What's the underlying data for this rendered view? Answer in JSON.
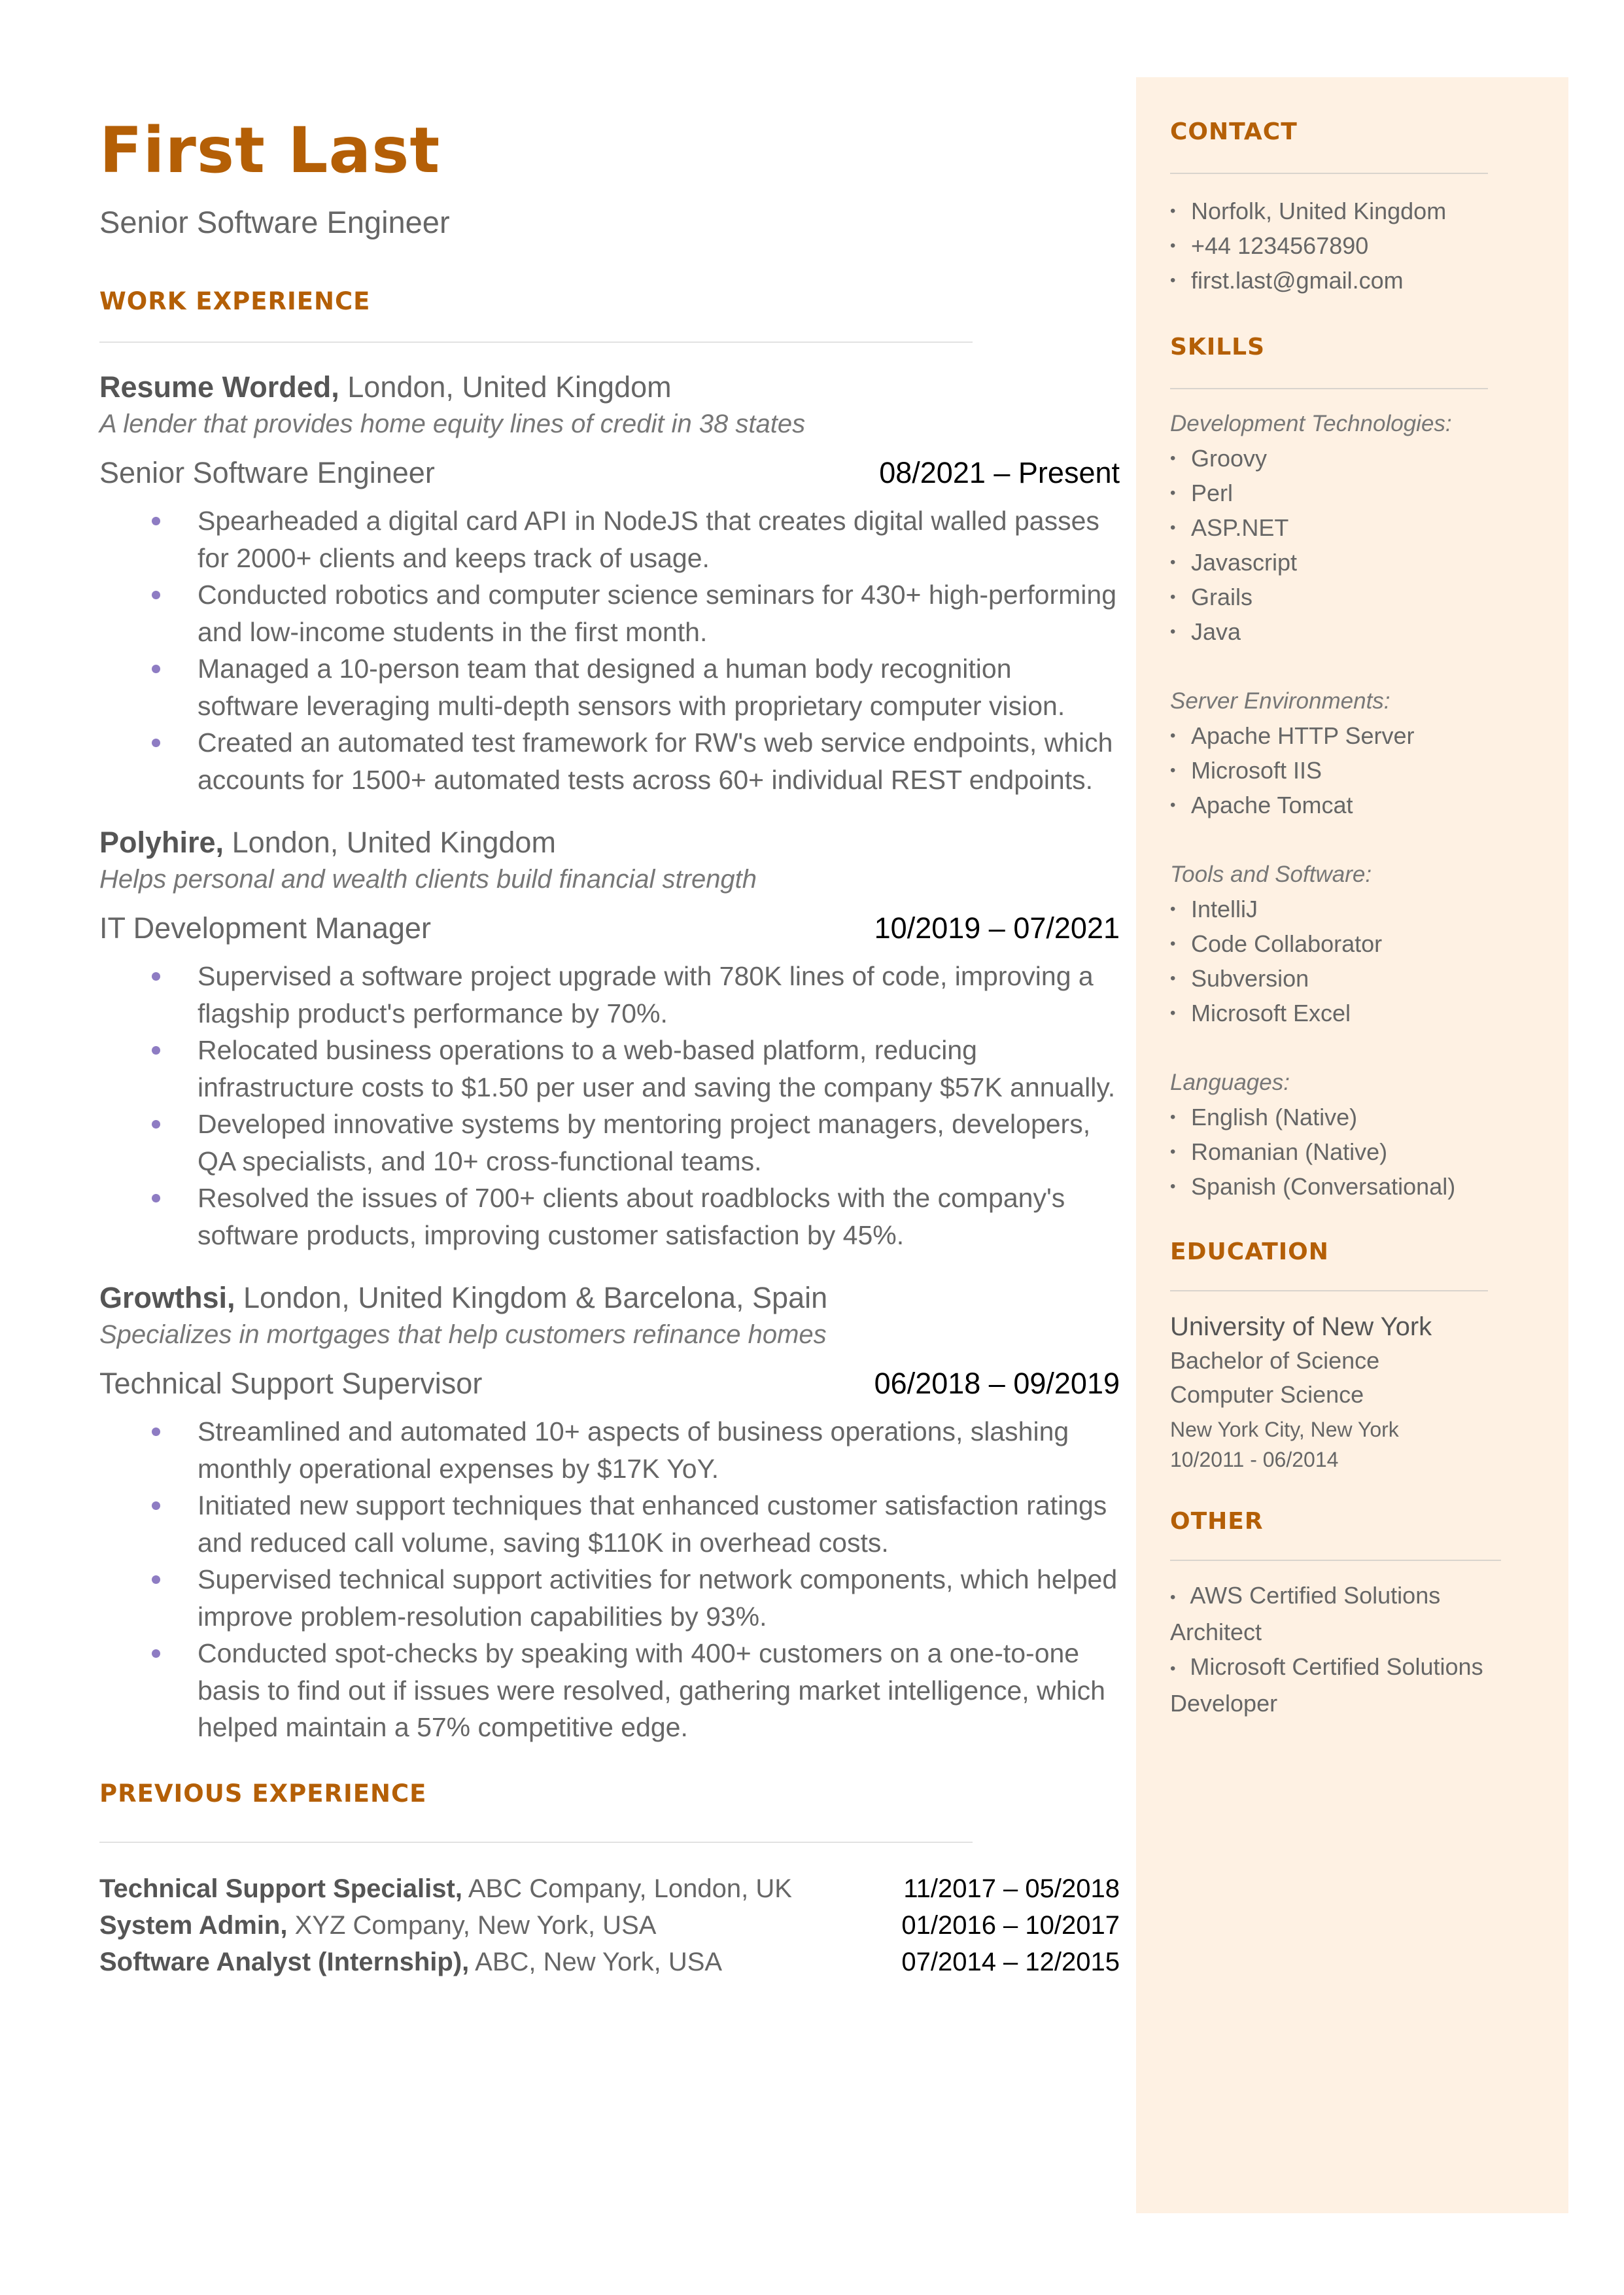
{
  "header": {
    "name": "First Last",
    "title": "Senior Software Engineer"
  },
  "colors": {
    "accent": "#b45f06",
    "bullet": "#8e7cc3",
    "sidebar_bg": "#fef1e3",
    "text": "#666666"
  },
  "work": {
    "section_title": "WORK EXPERIENCE",
    "jobs": [
      {
        "company": "Resume Worded,",
        "location": "London, United Kingdom",
        "description": "A lender that provides home equity lines of credit in 38 states",
        "role": "Senior Software Engineer",
        "dates": "08/2021 – Present",
        "bullets": [
          "Spearheaded a digital card API in NodeJS that creates digital walled passes for 2000+ clients and keeps track of usage.",
          "Conducted robotics and computer science seminars for 430+ high-performing and low-income students in the first month.",
          "Managed a 10-person team that designed a human body recognition software leveraging multi-depth sensors with proprietary computer vision.",
          "Created an automated test framework for RW's web service endpoints, which accounts for 1500+ automated tests across 60+ individual REST endpoints."
        ]
      },
      {
        "company": "Polyhire,",
        "location": "London, United Kingdom",
        "description": "Helps personal and wealth clients build financial strength",
        "role": "IT Development Manager",
        "dates": "10/2019 – 07/2021",
        "bullets": [
          "Supervised a software project upgrade with 780K lines of code, improving a flagship product's performance by 70%.",
          "Relocated business operations to a web-based platform, reducing infrastructure costs to $1.50 per user and saving the company $57K annually.",
          "Developed innovative systems by mentoring project managers, developers, QA specialists, and 10+ cross-functional teams.",
          "Resolved the issues of 700+ clients about roadblocks with the company's software products, improving customer satisfaction by 45%."
        ]
      },
      {
        "company": "Growthsi,",
        "location": "London, United Kingdom & Barcelona, Spain",
        "description": "Specializes in mortgages that help customers refinance homes",
        "role": "Technical Support Supervisor",
        "dates": "06/2018 – 09/2019",
        "bullets": [
          "Streamlined and automated 10+ aspects of business operations, slashing monthly operational expenses by $17K YoY.",
          "Initiated new support techniques that enhanced customer satisfaction ratings and reduced call volume, saving $110K in overhead costs.",
          "Supervised technical support activities for network components, which helped improve problem-resolution capabilities by 93%.",
          "Conducted spot-checks by speaking with 400+ customers on a one-to-one basis to find out if issues were resolved, gathering market intelligence, which helped maintain a 57% competitive edge."
        ]
      }
    ]
  },
  "previous": {
    "section_title": "PREVIOUS EXPERIENCE",
    "items": [
      {
        "role": "Technical Support Specialist,",
        "detail": "ABC Company, London, UK",
        "dates": "11/2017 – 05/2018"
      },
      {
        "role": "System Admin,",
        "detail": "XYZ Company, New York, USA",
        "dates": "01/2016 – 10/2017"
      },
      {
        "role": "Software Analyst (Internship),",
        "detail": "ABC, New York, USA",
        "dates": "07/2014 – 12/2015"
      }
    ]
  },
  "sidebar": {
    "contact": {
      "title": "CONTACT",
      "items": [
        "Norfolk, United Kingdom",
        "+44 1234567890",
        "first.last@gmail.com"
      ]
    },
    "skills": {
      "title": "SKILLS",
      "groups": [
        {
          "label": "Development Technologies:",
          "items": [
            "Groovy",
            "Perl",
            "ASP.NET",
            "Javascript",
            "Grails",
            "Java"
          ]
        },
        {
          "label": "Server Environments:",
          "items": [
            "Apache HTTP Server",
            "Microsoft IIS",
            "Apache Tomcat"
          ]
        },
        {
          "label": "Tools and Software:",
          "items": [
            "IntelliJ",
            "Code Collaborator",
            "Subversion",
            "Microsoft Excel"
          ]
        },
        {
          "label": "Languages:",
          "items": [
            "English (Native)",
            "Romanian (Native)",
            "Spanish (Conversational)"
          ]
        }
      ]
    },
    "education": {
      "title": "EDUCATION",
      "school": "University of New York",
      "degree": "Bachelor of Science",
      "major": "Computer Science",
      "location": "New York City, New York",
      "dates": "10/2011 - 06/2014"
    },
    "other": {
      "title": "OTHER",
      "items": [
        "AWS Certified Solutions Architect",
        "Microsoft Certified Solutions Developer"
      ]
    }
  }
}
